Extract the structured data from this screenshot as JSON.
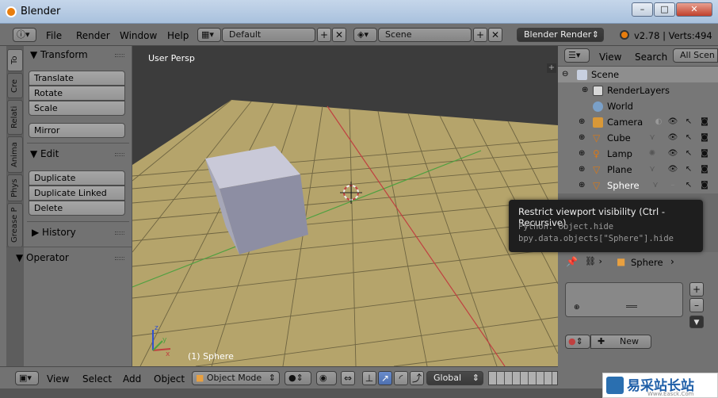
{
  "window": {
    "title": "Blender",
    "min": "–",
    "max": "□",
    "close": "✕"
  },
  "menu": {
    "items": [
      "File",
      "Render",
      "Window",
      "Help"
    ],
    "layout": "Default",
    "scene": "Scene",
    "engine": "Blender Render",
    "version": "v2.78 | Verts:494"
  },
  "tabs": [
    "To",
    "Cre",
    "Relati",
    "Anima",
    "Phys",
    "Grease P"
  ],
  "shelf": {
    "transform": {
      "header": "Transform",
      "buttons": [
        "Translate",
        "Rotate",
        "Scale"
      ],
      "mirror": "Mirror"
    },
    "edit": {
      "header": "Edit",
      "buttons": [
        "Duplicate",
        "Duplicate Linked",
        "Delete"
      ]
    },
    "history": "History",
    "operator": "Operator"
  },
  "viewport": {
    "label": "User Persp",
    "object": "(1) Sphere",
    "axis_x": "x",
    "axis_y": "y",
    "axis_z": "z"
  },
  "vpheader": {
    "menus": [
      "View",
      "Select",
      "Add",
      "Object"
    ],
    "mode": "Object Mode",
    "orientation": "Global"
  },
  "outliner": {
    "menus": [
      "View",
      "Search"
    ],
    "filter": "All Scen",
    "rows": [
      {
        "name": "Scene",
        "indent": 0
      },
      {
        "name": "RenderLayers",
        "indent": 1
      },
      {
        "name": "World",
        "indent": 1
      },
      {
        "name": "Camera",
        "indent": 1
      },
      {
        "name": "Cube",
        "indent": 1
      },
      {
        "name": "Lamp",
        "indent": 1
      },
      {
        "name": "Plane",
        "indent": 1
      },
      {
        "name": "Sphere",
        "indent": 1
      }
    ]
  },
  "tooltip": {
    "title": "Restrict viewport visibility (Ctrl - Recursive)",
    "python1": "Python: Object.hide",
    "python2": "bpy.data.objects[\"Sphere\"].hide"
  },
  "props": {
    "object": "Sphere",
    "new_button": "New"
  },
  "watermark": {
    "text": "易采站长站",
    "sub": "Www.Easck.Com"
  },
  "colors": {
    "grid_floor": "#b5a46b",
    "cube": "#8d8ea3",
    "x_axis": "#c04040",
    "y_axis": "#4fa040"
  }
}
